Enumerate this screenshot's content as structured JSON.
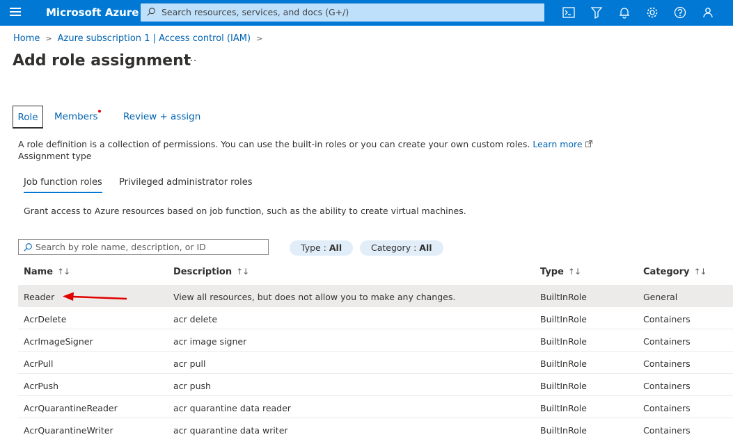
{
  "header": {
    "brand": "Microsoft Azure",
    "search_placeholder": "Search resources, services, and docs (G+/)",
    "icons": [
      "cloud-shell-icon",
      "directory-filter-icon",
      "notifications-icon",
      "settings-icon",
      "help-icon",
      "feedback-icon"
    ]
  },
  "breadcrumb": {
    "home": "Home",
    "parent": "Azure subscription 1 | Access control (IAM)"
  },
  "page": {
    "title": "Add role assignment",
    "more": "···"
  },
  "tabs": {
    "role": "Role",
    "members": "Members",
    "review": "Review + assign"
  },
  "intro": {
    "text": "A role definition is a collection of permissions. You can use the built-in roles or you can create your own custom roles.",
    "learn_more": "Learn more",
    "assignment_type": "Assignment type"
  },
  "subtabs": {
    "job": "Job function roles",
    "privileged": "Privileged administrator roles"
  },
  "grant_text": "Grant access to Azure resources based on job function, such as the ability to create virtual machines.",
  "filters": {
    "search_placeholder": "Search by role name, description, or ID",
    "type_label": "Type : ",
    "type_value": "All",
    "category_label": "Category : ",
    "category_value": "All"
  },
  "table": {
    "columns": [
      "Name",
      "Description",
      "Type",
      "Category"
    ],
    "sort_glyph": "↑↓",
    "rows": [
      {
        "name": "Reader",
        "description": "View all resources, but does not allow you to make any changes.",
        "type": "BuiltInRole",
        "category": "General"
      },
      {
        "name": "AcrDelete",
        "description": "acr delete",
        "type": "BuiltInRole",
        "category": "Containers"
      },
      {
        "name": "AcrImageSigner",
        "description": "acr image signer",
        "type": "BuiltInRole",
        "category": "Containers"
      },
      {
        "name": "AcrPull",
        "description": "acr pull",
        "type": "BuiltInRole",
        "category": "Containers"
      },
      {
        "name": "AcrPush",
        "description": "acr push",
        "type": "BuiltInRole",
        "category": "Containers"
      },
      {
        "name": "AcrQuarantineReader",
        "description": "acr quarantine data reader",
        "type": "BuiltInRole",
        "category": "Containers"
      },
      {
        "name": "AcrQuarantineWriter",
        "description": "acr quarantine data writer",
        "type": "BuiltInRole",
        "category": "Containers"
      }
    ]
  },
  "colors": {
    "accent": "#0078d4",
    "selected_row": "#edebe9",
    "annotation_arrow": "#e00000",
    "notification_dot": "#e00000"
  }
}
